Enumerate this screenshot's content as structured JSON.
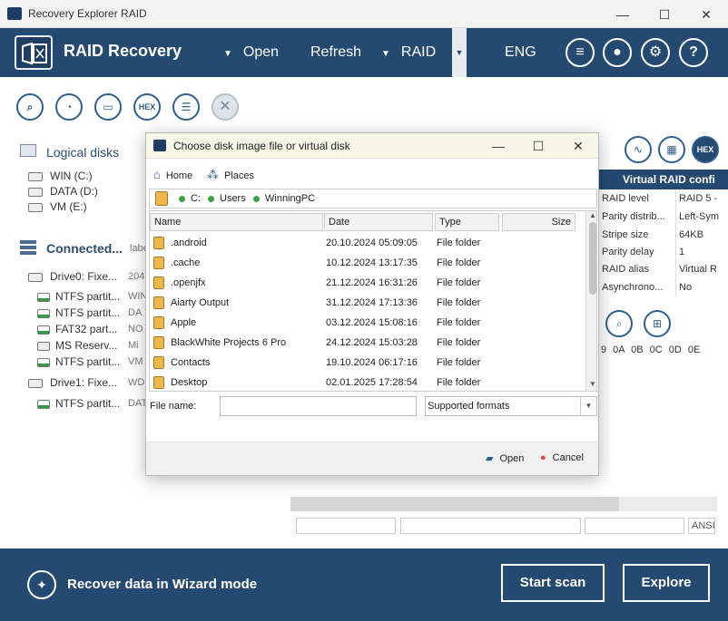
{
  "window": {
    "title": "Recovery Explorer RAID",
    "min": "—",
    "max": "☐",
    "close": "✕"
  },
  "header": {
    "brand": "RAID Recovery",
    "menu": [
      {
        "label": "Open"
      },
      {
        "label": "Refresh"
      },
      {
        "label": "RAID"
      }
    ],
    "language": "ENG",
    "dropdown_glyph": "▼",
    "menu_arrow": "▼"
  },
  "left": {
    "logical_title": "Logical disks",
    "logical": [
      "WIN (C:)",
      "DATA (D:)",
      "VM (E:)"
    ],
    "connected_title": "Connected...",
    "connected_side": "labe",
    "drives": [
      {
        "label": "Drive0: Fixe...",
        "side": "204",
        "parts": [
          {
            "label": "NTFS partit...",
            "side": "WIN"
          },
          {
            "label": "NTFS partit...",
            "side": "DA"
          },
          {
            "label": "FAT32 part...",
            "side": "NO"
          },
          {
            "label": "MS Reserv...",
            "side": "Mi"
          },
          {
            "label": "NTFS partit...",
            "side": "VM"
          }
        ]
      },
      {
        "label": "Drive1: Fixe...",
        "side": "WD",
        "parts": [
          {
            "label": "NTFS partit...",
            "side": "DAT"
          }
        ]
      }
    ]
  },
  "right": {
    "hex_label": "HEX",
    "title": "Virtual RAID confi",
    "rows": [
      {
        "k": "RAID level",
        "v": "RAID 5 -"
      },
      {
        "k": "Parity distrib...",
        "v": "Left-Sym"
      },
      {
        "k": "Stripe size",
        "v": "64KB"
      },
      {
        "k": "Parity delay",
        "v": "1"
      },
      {
        "k": "RAID alias",
        "v": "Virtual R"
      },
      {
        "k": "Asynchrono...",
        "v": "No"
      }
    ],
    "hex_header": "9 0A 0B 0C 0D 0E",
    "ansi": "ANSI"
  },
  "toolbar": {
    "hex_label": "HEX"
  },
  "dialog": {
    "title": "Choose disk image file or virtual disk",
    "home": "Home",
    "places": "Places",
    "path": [
      "C:",
      "Users",
      "WinningPC"
    ],
    "columns": {
      "name": "Name",
      "date": "Date",
      "type": "Type",
      "size": "Size"
    },
    "files": [
      {
        "name": ".android",
        "date": "20.10.2024 05:09:05",
        "type": "File folder"
      },
      {
        "name": ".cache",
        "date": "10.12.2024 13:17:35",
        "type": "File folder"
      },
      {
        "name": ".openjfx",
        "date": "21.12.2024 16:31:26",
        "type": "File folder"
      },
      {
        "name": "Aiarty Output",
        "date": "31.12.2024 17:13:36",
        "type": "File folder"
      },
      {
        "name": "Apple",
        "date": "03.12.2024 15:08:16",
        "type": "File folder"
      },
      {
        "name": "BlackWhite Projects 6 Pro",
        "date": "24.12.2024 15:03:28",
        "type": "File folder"
      },
      {
        "name": "Contacts",
        "date": "19.10.2024 06:17:16",
        "type": "File folder"
      },
      {
        "name": "Desktop",
        "date": "02.01.2025 17:28:54",
        "type": "File folder"
      }
    ],
    "file_name_label": "File name:",
    "file_name_value": "",
    "file_type": "Supported formats",
    "open": "Open",
    "cancel": "Cancel"
  },
  "footer": {
    "wizard": "Recover data in Wizard mode",
    "start_scan": "Start scan",
    "explore": "Explore"
  },
  "colors": {
    "brand": "#244a72",
    "accent": "#2e5f8f",
    "folder": "#f0b84a",
    "ok": "#3aa34a",
    "cancel": "#e04848"
  }
}
